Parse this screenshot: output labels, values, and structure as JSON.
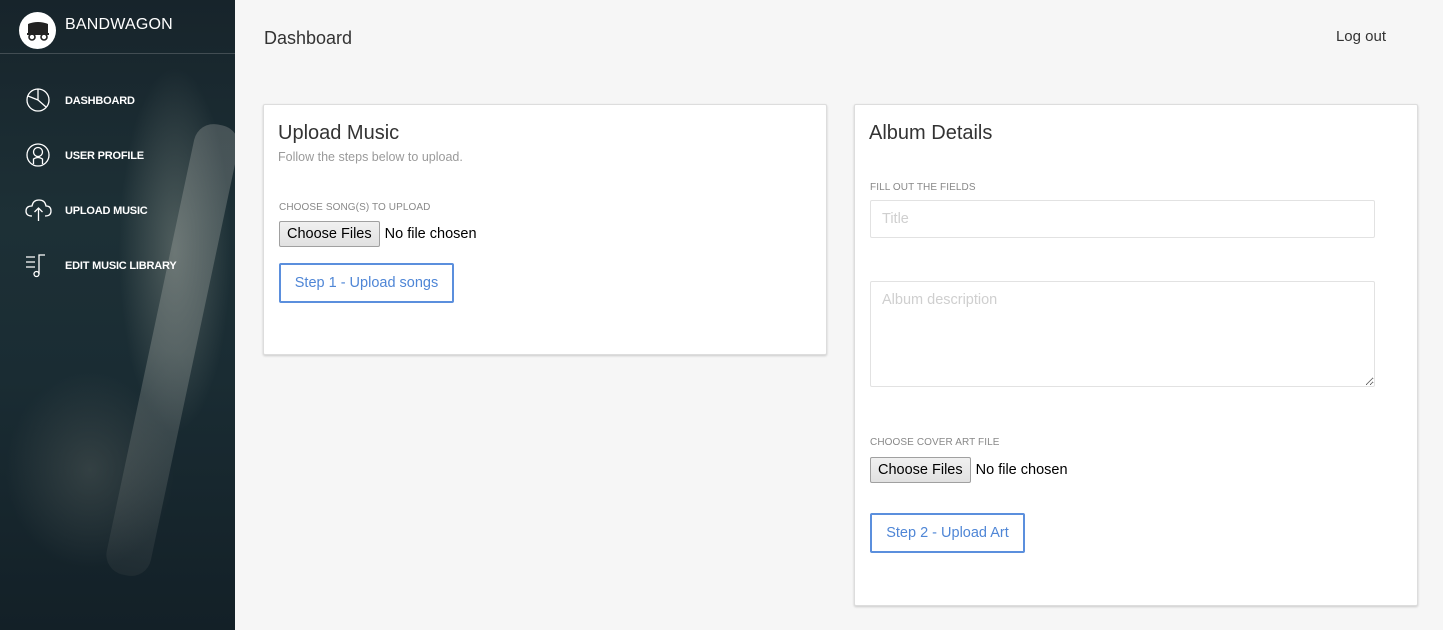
{
  "brand": {
    "name": "BANDWAGON",
    "logo_icon": "wagon-icon"
  },
  "sidebar": {
    "items": [
      {
        "label": "DASHBOARD",
        "icon": "pie-chart-icon"
      },
      {
        "label": "USER PROFILE",
        "icon": "user-icon"
      },
      {
        "label": "UPLOAD MUSIC",
        "icon": "cloud-upload-icon"
      },
      {
        "label": "EDIT MUSIC LIBRARY",
        "icon": "music-list-icon"
      }
    ]
  },
  "header": {
    "title": "Dashboard",
    "logout_label": "Log out"
  },
  "upload_card": {
    "title": "Upload Music",
    "subtitle": "Follow the steps below to upload.",
    "songs_label": "CHOOSE SONG(S) TO UPLOAD",
    "file_button": "Choose Files",
    "file_status": "No file chosen",
    "step_button": "Step 1 - Upload songs"
  },
  "album_card": {
    "title": "Album Details",
    "fields_label": "FILL OUT THE FIELDS",
    "title_placeholder": "Title",
    "title_value": "",
    "description_placeholder": "Album description",
    "description_value": "",
    "cover_label": "CHOOSE COVER ART FILE",
    "file_button": "Choose Files",
    "file_status": "No file chosen",
    "step_button": "Step 2 - Upload Art"
  },
  "colors": {
    "accent": "#4f86d6",
    "sidebar": "#1d3036",
    "background": "#f6f6f6"
  }
}
